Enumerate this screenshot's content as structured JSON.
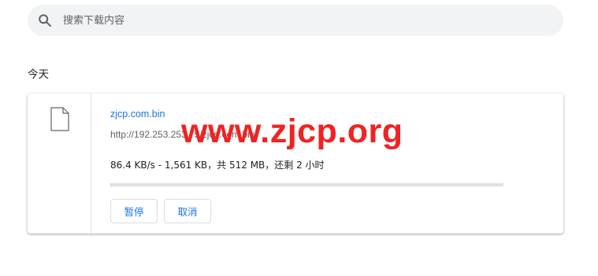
{
  "search": {
    "placeholder": "搜索下载内容",
    "icon": "search-icon"
  },
  "date_header": "今天",
  "download": {
    "icon": "file-icon",
    "file_name": "zjcp.com.bin",
    "url": "http://192.253.253.75/zjcp.com.bin",
    "status": "86.4 KB/s - 1,561 KB，共 512 MB，还剩 2 小时",
    "progress_fraction": 0.003,
    "pause_label": "暂停",
    "cancel_label": "取消"
  },
  "watermark": "www.zjcp.org",
  "colors": {
    "link": "#1a73e8",
    "watermark": "#f02222",
    "search_bg": "#f1f3f4"
  }
}
